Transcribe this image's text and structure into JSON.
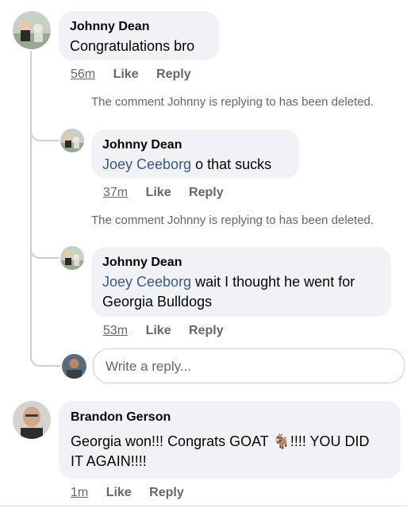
{
  "comments": [
    {
      "author": "Johnny Dean",
      "text": "Congratulations bro",
      "time": "56m",
      "like": "Like",
      "reply": "Reply"
    }
  ],
  "replies": [
    {
      "deleted_notice": "The comment Johnny is replying to has been deleted.",
      "author": "Johnny Dean",
      "mention": "Joey Ceeborg",
      "text": " o that sucks",
      "time": "37m",
      "like": "Like",
      "reply": "Reply"
    },
    {
      "deleted_notice": "The comment Johnny is replying to has been deleted.",
      "author": "Johnny Dean",
      "mention": "Joey Ceeborg",
      "text_line1": " wait I thought he went for",
      "text_line2": "Georgia Bulldogs",
      "time": "53m",
      "like": "Like",
      "reply": "Reply"
    }
  ],
  "reply_box": {
    "placeholder": "Write a reply..."
  },
  "second_comment": {
    "author": "Brandon Gerson",
    "text_line1a": "Georgia won!!! Congrats GOAT ",
    "goat_emoji": "🐐",
    "text_line1b": "!!!! YOU DID",
    "text_line2": "IT AGAIN!!!!",
    "time": "1m",
    "like": "Like",
    "reply": "Reply"
  },
  "colors": {
    "bubble": "#f0f2f5",
    "mention": "#385898",
    "meta": "#65676b"
  }
}
